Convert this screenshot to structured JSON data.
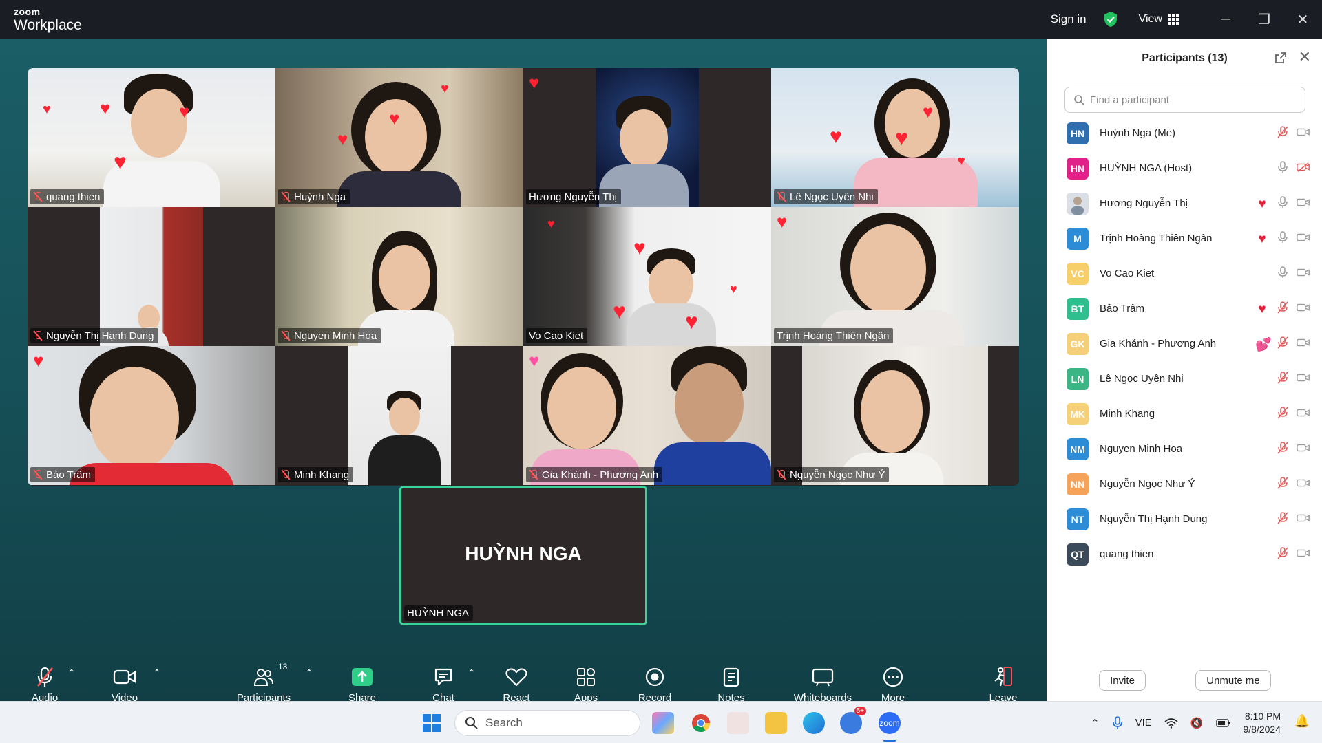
{
  "titlebar": {
    "brand_top": "zoom",
    "brand_name": "Workplace",
    "sign_in": "Sign in",
    "view": "View"
  },
  "gallery": [
    {
      "name": "quang thien"
    },
    {
      "name": "Huỳnh Nga"
    },
    {
      "name": "Hương Nguyễn Thị"
    },
    {
      "name": "Lê Ngọc Uyên Nhi"
    },
    {
      "name": "Nguyễn Thị Hạnh Dung"
    },
    {
      "name": "Nguyen Minh Hoa"
    },
    {
      "name": "Vo Cao Kiet"
    },
    {
      "name": "Trịnh Hoàng Thiên Ngân"
    },
    {
      "name": "Bảo Trâm"
    },
    {
      "name": "Minh Khang"
    },
    {
      "name": "Gia Khánh - Phương Anh"
    },
    {
      "name": "Nguyễn Ngọc Như Ý"
    }
  ],
  "active_speaker": {
    "display": "HUỲNH NGA",
    "name": "HUỲNH NGA"
  },
  "toolbar": {
    "audio": "Audio",
    "video": "Video",
    "participants": "Participants",
    "participants_count": "13",
    "share": "Share",
    "chat": "Chat",
    "react": "React",
    "apps": "Apps",
    "record": "Record",
    "notes": "Notes",
    "whiteboards": "Whiteboards",
    "more": "More",
    "leave": "Leave"
  },
  "panel": {
    "title": "Participants (13)",
    "search_placeholder": "Find a participant",
    "invite": "Invite",
    "unmute": "Unmute me",
    "participants": [
      {
        "initials": "HN",
        "name": "Huỳnh Nga (Me)",
        "color": "#2f6fb0",
        "heart": "",
        "mic": "muted",
        "cam": "on"
      },
      {
        "initials": "HN",
        "name": "HUỲNH NGA (Host)",
        "color": "#e0218a",
        "heart": "",
        "mic": "on",
        "cam": "off"
      },
      {
        "initials": "",
        "name": "Hương Nguyễn Thị",
        "color": "#c9c9c9",
        "heart": "♥",
        "mic": "on",
        "cam": "on"
      },
      {
        "initials": "M",
        "name": "Trịnh Hoàng Thiên Ngân",
        "color": "#2d8cd6",
        "heart": "♥",
        "mic": "on",
        "cam": "on"
      },
      {
        "initials": "VC",
        "name": "Vo Cao Kiet",
        "color": "#f7cf6a",
        "heart": "",
        "mic": "on",
        "cam": "on"
      },
      {
        "initials": "BT",
        "name": "Bảo Trâm",
        "color": "#2fbf8f",
        "heart": "♥",
        "mic": "muted",
        "cam": "on"
      },
      {
        "initials": "GK",
        "name": "Gia Khánh - Phương Anh",
        "color": "#f6cf79",
        "heart": "💕",
        "mic": "muted",
        "cam": "on"
      },
      {
        "initials": "LN",
        "name": "Lê Ngọc Uyên Nhi",
        "color": "#3ab583",
        "heart": "",
        "mic": "muted",
        "cam": "on"
      },
      {
        "initials": "MK",
        "name": "Minh Khang",
        "color": "#f6cf79",
        "heart": "",
        "mic": "muted",
        "cam": "on"
      },
      {
        "initials": "NM",
        "name": "Nguyen Minh Hoa",
        "color": "#2d8cd6",
        "heart": "",
        "mic": "muted",
        "cam": "on"
      },
      {
        "initials": "NN",
        "name": "Nguyễn Ngọc Như Ý",
        "color": "#f5a25a",
        "heart": "",
        "mic": "muted",
        "cam": "on"
      },
      {
        "initials": "NT",
        "name": "Nguyễn Thị Hạnh Dung",
        "color": "#2d8cd6",
        "heart": "",
        "mic": "muted",
        "cam": "on"
      },
      {
        "initials": "QT",
        "name": "quang thien",
        "color": "#3b4b5a",
        "heart": "",
        "mic": "muted",
        "cam": "on"
      }
    ]
  },
  "taskbar": {
    "search": "Search",
    "language": "VIE",
    "time": "8:10 PM",
    "date": "9/8/2024",
    "mail_badge": "5+"
  },
  "colors": {
    "accent_green": "#3fd19b",
    "muted_red": "#ff5a5a",
    "heart_red": "#ff2233"
  }
}
